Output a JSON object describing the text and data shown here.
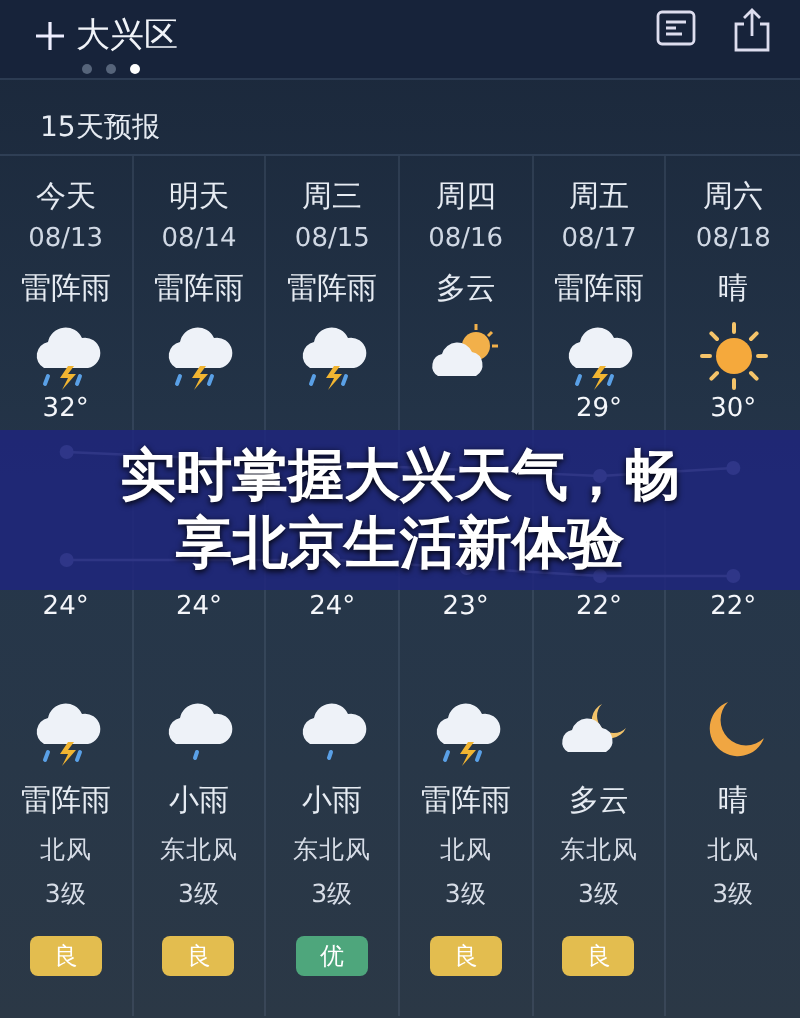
{
  "header": {
    "city": "大兴区",
    "pages": [
      {
        "selected": false
      },
      {
        "selected": false
      },
      {
        "selected": true
      }
    ]
  },
  "section_title": "15天预报",
  "days": [
    {
      "name": "今天",
      "date": "08/13",
      "day_condition": "雷阵雨",
      "day_icon": {
        "kind": "thunderstorm"
      },
      "high": "32°",
      "low": "24°",
      "night_icon": {
        "kind": "thunderstorm"
      },
      "night_condition": "雷阵雨",
      "wind": "北风",
      "wind_level": "3级",
      "aqi": {
        "label": "良",
        "color": "#e3bd4f"
      }
    },
    {
      "name": "明天",
      "date": "08/14",
      "day_condition": "雷阵雨",
      "day_icon": {
        "kind": "thunderstorm"
      },
      "low": "24°",
      "night_icon": {
        "kind": "rain"
      },
      "night_condition": "小雨",
      "wind": "东北风",
      "wind_level": "3级",
      "aqi": {
        "label": "良",
        "color": "#e3bd4f"
      }
    },
    {
      "name": "周三",
      "date": "08/15",
      "day_condition": "雷阵雨",
      "day_icon": {
        "kind": "thunderstorm"
      },
      "low": "24°",
      "night_icon": {
        "kind": "rain"
      },
      "night_condition": "小雨",
      "wind": "东北风",
      "wind_level": "3级",
      "aqi": {
        "label": "优",
        "color": "#4ea67c"
      }
    },
    {
      "name": "周四",
      "date": "08/16",
      "day_condition": "多云",
      "day_icon": {
        "kind": "cloudy-sun"
      },
      "low": "23°",
      "night_icon": {
        "kind": "thunderstorm"
      },
      "night_condition": "雷阵雨",
      "wind": "北风",
      "wind_level": "3级",
      "aqi": {
        "label": "良",
        "color": "#e3bd4f"
      }
    },
    {
      "name": "周五",
      "date": "08/17",
      "day_condition": "雷阵雨",
      "day_icon": {
        "kind": "thunderstorm"
      },
      "high": "29°",
      "low": "22°",
      "night_icon": {
        "kind": "cloudy-moon"
      },
      "night_condition": "多云",
      "wind": "东北风",
      "wind_level": "3级",
      "aqi": {
        "label": "良",
        "color": "#e3bd4f"
      }
    },
    {
      "name": "周六",
      "date": "08/18",
      "day_condition": "晴",
      "day_icon": {
        "kind": "sunny"
      },
      "high": "30°",
      "low": "22°",
      "night_icon": {
        "kind": "moon"
      },
      "night_condition": "晴",
      "wind": "北风",
      "wind_level": "3级"
    }
  ],
  "banner": "实时掌握大兴天气，畅享北京生活新体验"
}
